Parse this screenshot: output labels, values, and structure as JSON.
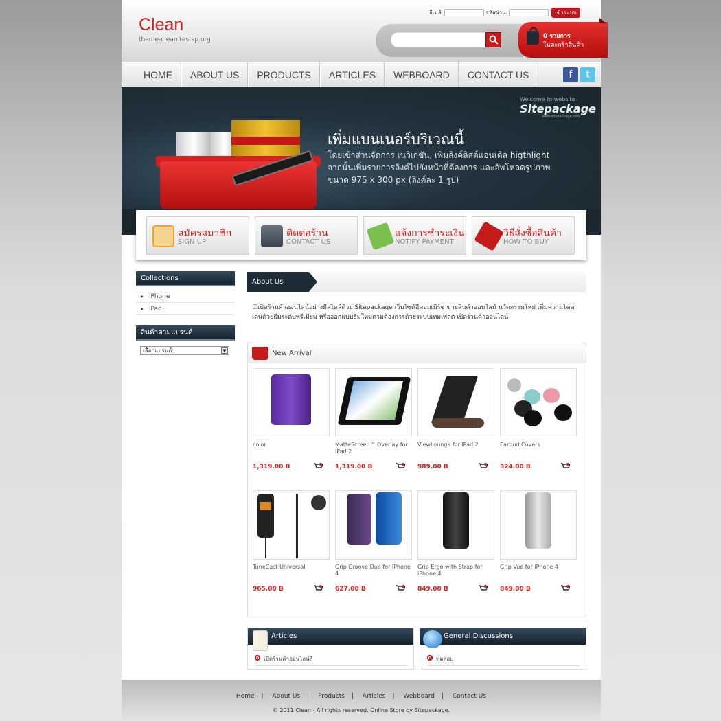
{
  "header": {
    "logo": "Clean",
    "subdomain": "theme-clean.testsp.org",
    "login": {
      "email_label": "อีเมล์:",
      "password_label": "รหัสผ่าน:",
      "submit": "เข้าระบบ"
    },
    "cart": {
      "count": "0 รายการ",
      "label": "ในตะกร้าสินค้า"
    }
  },
  "nav": [
    "HOME",
    "ABOUT US",
    "PRODUCTS",
    "ARTICLES",
    "WEBBOARD",
    "CONTACT US"
  ],
  "social": {
    "facebook": "f",
    "twitter": "t"
  },
  "banner": {
    "welcome": "Welcome to website",
    "brand": "Sitepackage",
    "url": "www.sitepackage.com",
    "title": "เพิ่มแบนเนอร์บริเวณนี้",
    "lines": [
      "โดยเข้าส่วนจัดการ เนวิเกชัน, เพิ่มลิงค์ลิสต์แอนเดิล higthlight",
      "จากนั้นเพิ่มรายการลิงค์ไปยังหน้าที่ต้องการ และอัพโหลดรูปภาพ",
      "ขนาด 975 x 300 px (ลิงค์ละ 1 รูป)"
    ]
  },
  "quick_links": [
    {
      "title": "สมัครสมาชิก",
      "sub": "SIGN UP",
      "icon": "pencil-note-icon",
      "color": "#e8a33a"
    },
    {
      "title": "ติดต่อร้าน",
      "sub": "CONTACT US",
      "icon": "phone-icon",
      "color": "#4a5560"
    },
    {
      "title": "แจ้งการชำระเงิน",
      "sub": "NOTIFY PAYMENT",
      "icon": "money-icon",
      "color": "#5aa33a"
    },
    {
      "title": "วิธีสั่งซื้อสินค้า",
      "sub": "HOW TO BUY",
      "icon": "sale-tag-icon",
      "color": "#c41b1b"
    }
  ],
  "sidebar": {
    "collections_title": "Collections",
    "collections": [
      "iPhone",
      "iPad"
    ],
    "brand_title": "สินค้าตามแบรนด์",
    "brand_select": "เลือกแบรนด์:"
  },
  "about": {
    "title": "About Us",
    "text": "☐เปิดร้านค้าออนไลน์อย่างมีสไตล์ด้วย Sitepackage เว็บไซต์อีคอมเมิร์ซ ขายสินค้าออนไลน์ นวัตกรรมใหม่ เพิ่มความโดดเด่นด้วยธีมระดับพรีเมียม หรือออกแบบธีมใหม่ตามต้องการด้วยระบบเทมเพลต เปิดร้านค้าออนไลน์"
  },
  "new_arrival": {
    "title": "New Arrival",
    "products": [
      {
        "name": "color",
        "price": "1,319.00 B",
        "img": "ipad-case-purple"
      },
      {
        "name": "MatteScreen™ Overlay for iPad 2",
        "price": "1,319.00 B",
        "img": "ipad-screen"
      },
      {
        "name": "ViewLounge for iPad 2",
        "price": "989.00 B",
        "img": "ipad-stand"
      },
      {
        "name": "Earbud Covers",
        "price": "324.00 B",
        "img": "earbud-covers"
      },
      {
        "name": "TuneCast Universal",
        "price": "965.00 B",
        "img": "fm-transmitter"
      },
      {
        "name": "Grip Groove Duo for iPhone 4",
        "price": "627.00 B",
        "img": "iphone-case-duo"
      },
      {
        "name": "Grip Ergo with Strap for iPhone 4",
        "price": "849.00 B",
        "img": "iphone-case-black"
      },
      {
        "name": "Grip Vue for iPhone 4",
        "price": "849.00 B",
        "img": "iphone-case-clear"
      }
    ]
  },
  "articles": {
    "title": "Articles",
    "items": [
      "เปิดร้านค้าออนไลน์?"
    ]
  },
  "discussions": {
    "title": "General Discussions",
    "items": [
      "ทดสอบ"
    ]
  },
  "footer": {
    "links": [
      "Home",
      "About Us",
      "Products",
      "Articles",
      "Webboard",
      "Contact Us"
    ],
    "copyright": "© 2011 Clean - All rights reserved. Online Store by Sitepackage."
  }
}
